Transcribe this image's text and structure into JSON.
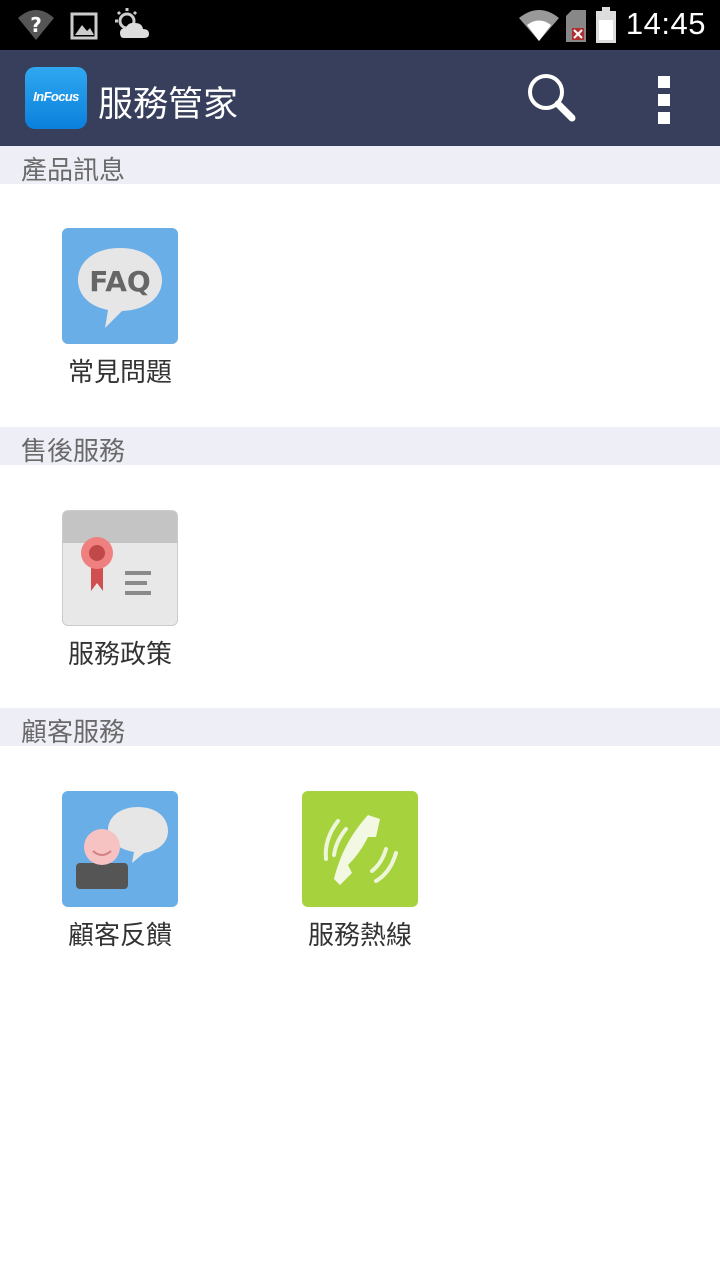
{
  "status_bar": {
    "time": "14:45",
    "icons": [
      "wifi-unknown-icon",
      "image-notification-icon",
      "weather-icon",
      "wifi-signal-icon",
      "no-sim-icon",
      "battery-icon"
    ]
  },
  "action_bar": {
    "logo_text": "InFocus",
    "title": "服務管家",
    "actions": [
      "search-icon",
      "overflow-menu-icon"
    ]
  },
  "sections": [
    {
      "header": "產品訊息",
      "items": [
        {
          "label": "常見問題",
          "icon": "faq-icon",
          "icon_text": "FAQ"
        }
      ]
    },
    {
      "header": "售後服務",
      "items": [
        {
          "label": "服務政策",
          "icon": "certificate-icon"
        }
      ]
    },
    {
      "header": "顧客服務",
      "items": [
        {
          "label": "顧客反饋",
          "icon": "feedback-icon"
        },
        {
          "label": "服務熱線",
          "icon": "phone-icon"
        }
      ]
    }
  ],
  "colors": {
    "action_bar": "#373f5c",
    "section_header": "#eeeef6",
    "faq_blue": "#6aaee8",
    "hotline_green": "#a6d23e"
  }
}
